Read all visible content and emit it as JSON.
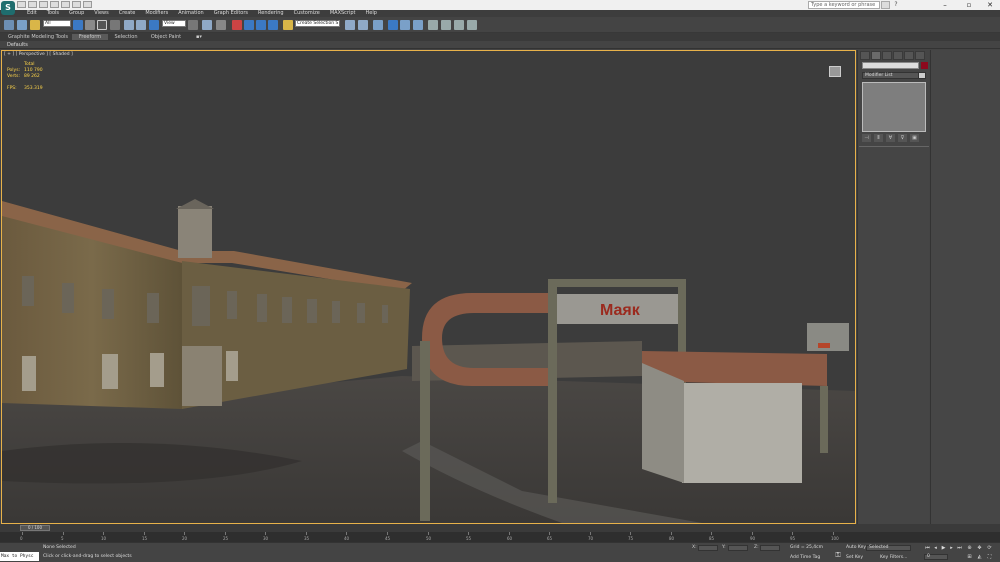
{
  "titlebar": {
    "search_placeholder": "Type a keyword or phrase",
    "logo_text": "S",
    "minimize": "–",
    "restore": "▫",
    "close": "✕",
    "help": "?"
  },
  "menu": [
    "Edit",
    "Tools",
    "Group",
    "Views",
    "Create",
    "Modifiers",
    "Animation",
    "Graph Editors",
    "Rendering",
    "Customize",
    "MAXScript",
    "Help"
  ],
  "toolbar": {
    "filter_value": "All",
    "refcoord_value": "View",
    "selection_set_value": "Create Selection S"
  },
  "ribbon": {
    "tabs": [
      "Graphite Modeling Tools",
      "Freeform",
      "Selection",
      "Object Paint"
    ],
    "defaults_label": "Defaults"
  },
  "viewport": {
    "label": "[ + ] [ Perspective ] [ Shaded ]",
    "stats": {
      "header": "Total",
      "polys_label": "Polys:",
      "polys_value": "110 790",
      "verts_label": "Verts:",
      "verts_value": "89 262",
      "fps_label": "FPS:",
      "fps_value": "353.319"
    },
    "sign_text": "Маяк"
  },
  "command_panel": {
    "modifier_list": "Modifier List",
    "object_color": "#8c0a1e"
  },
  "timeline": {
    "slider_label": "0 / 100",
    "ticks": [
      "0",
      "5",
      "10",
      "15",
      "20",
      "25",
      "30",
      "35",
      "40",
      "45",
      "50",
      "55",
      "60",
      "65",
      "70",
      "75",
      "80",
      "85",
      "90",
      "95",
      "100"
    ]
  },
  "status": {
    "script_listener": "Max to Physc",
    "selection_status": "None Selected",
    "prompt": "Click or click-and-drag to select objects",
    "x_label": "X:",
    "y_label": "Y:",
    "z_label": "Z:",
    "grid": "Grid = 25,4cm",
    "add_time_tag": "Add Time Tag",
    "auto_key": "Auto Key",
    "set_key": "Set Key",
    "selected_value": "Selected",
    "key_filters": "Key Filters...",
    "frame_value": "0"
  }
}
